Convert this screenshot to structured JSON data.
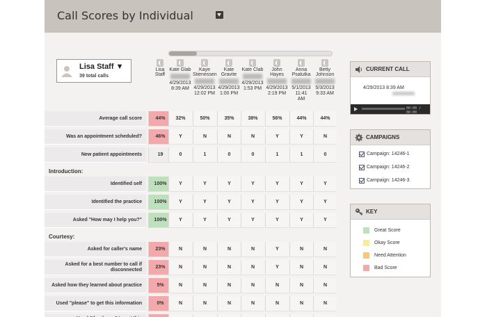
{
  "header": {
    "title": "Call Scores by Individual"
  },
  "user": {
    "name": "Lisa Staff ▼",
    "calls": "39 total calls"
  },
  "columns": [
    {
      "name": "Lisa\nStaff",
      "date": ""
    },
    {
      "name": "Kate Glab",
      "date": "4/29/2013\n8:39 AM"
    },
    {
      "name": "Kaye\nStienessen",
      "date": "4/29/2013\n12:02 PM"
    },
    {
      "name": "Kate\nGravite",
      "date": "4/29/2013\n1:00 PM"
    },
    {
      "name": "Kate Clab",
      "date": "4/29/2013\n1:53 PM"
    },
    {
      "name": "John\nHayes",
      "date": "4/29/2013\n2:19 PM"
    },
    {
      "name": "Anna\nPsalutka",
      "date": "5/1/2013\n11:41\nAM"
    },
    {
      "name": "Betty\nJohnson",
      "date": "5/3/2013\n9:33 AM"
    }
  ],
  "rows": [
    {
      "type": "row",
      "label": "Average call score",
      "me": "44%",
      "me_color": "red",
      "values": [
        "32%",
        "50%",
        "35%",
        "38%",
        "56%",
        "44%",
        "44%"
      ]
    },
    {
      "type": "row",
      "label": "Was an appointment scheduled?",
      "me": "46%",
      "me_color": "red",
      "values": [
        "Y",
        "N",
        "N",
        "N",
        "Y",
        "Y",
        "N"
      ]
    },
    {
      "type": "row",
      "label": "New patient appointments",
      "me": "19",
      "me_color": "none",
      "values": [
        "0",
        "1",
        "0",
        "0",
        "1",
        "1",
        "0"
      ]
    },
    {
      "type": "section",
      "label": "Introduction:"
    },
    {
      "type": "row",
      "label": "Identified self",
      "me": "100%",
      "me_color": "green",
      "values": [
        "Y",
        "Y",
        "Y",
        "Y",
        "Y",
        "Y",
        "Y"
      ]
    },
    {
      "type": "row",
      "label": "Identified the practice",
      "me": "100%",
      "me_color": "green",
      "values": [
        "Y",
        "Y",
        "Y",
        "Y",
        "Y",
        "Y",
        "Y"
      ]
    },
    {
      "type": "row",
      "label": "Asked \"How may I help you?\"",
      "me": "100%",
      "me_color": "green",
      "values": [
        "Y",
        "Y",
        "Y",
        "Y",
        "Y",
        "Y",
        "Y"
      ]
    },
    {
      "type": "section",
      "label": "Courtesy:"
    },
    {
      "type": "row",
      "label": "Asked for caller's name",
      "me": "23%",
      "me_color": "red",
      "values": [
        "N",
        "N",
        "N",
        "N",
        "Y",
        "N",
        "N"
      ]
    },
    {
      "type": "row",
      "label": "Asked for a best number to call if\ndisconnected",
      "me": "23%",
      "me_color": "red",
      "values": [
        "N",
        "N",
        "N",
        "N",
        "Y",
        "N",
        "N"
      ]
    },
    {
      "type": "row",
      "label": "Asked how they learned about practice",
      "me": "5%",
      "me_color": "red",
      "values": [
        "N",
        "N",
        "N",
        "N",
        "N",
        "N",
        "N"
      ]
    },
    {
      "type": "row",
      "label": "Used \"please\" to get this information",
      "me": "0%",
      "me_color": "red",
      "values": [
        "N",
        "N",
        "N",
        "N",
        "N",
        "N",
        "N"
      ]
    },
    {
      "type": "row",
      "label": "Used \"thank you\" to get this\ninformation",
      "me": "3%",
      "me_color": "red",
      "values": [
        "N",
        "N",
        "N",
        "N",
        "N",
        "N",
        "N"
      ]
    }
  ],
  "current_call": {
    "title": "CURRENT CALL",
    "date": "4/29/2013 8:39 AM",
    "time": "00:00 / 00:00"
  },
  "campaigns": {
    "title": "CAMPAIGNS",
    "items": [
      "Campaign: 14246-1",
      "Campaign: 14246-2",
      "Campaign: 14246-3"
    ]
  },
  "key": {
    "title": "KEY",
    "items": [
      {
        "label": "Great Score",
        "color": "#bfe0bd"
      },
      {
        "label": "Okay Score",
        "color": "#f7ee9c"
      },
      {
        "label": "Need Attention",
        "color": "#f7c77e"
      },
      {
        "label": "Bad Score",
        "color": "#f2a9ab"
      }
    ]
  }
}
